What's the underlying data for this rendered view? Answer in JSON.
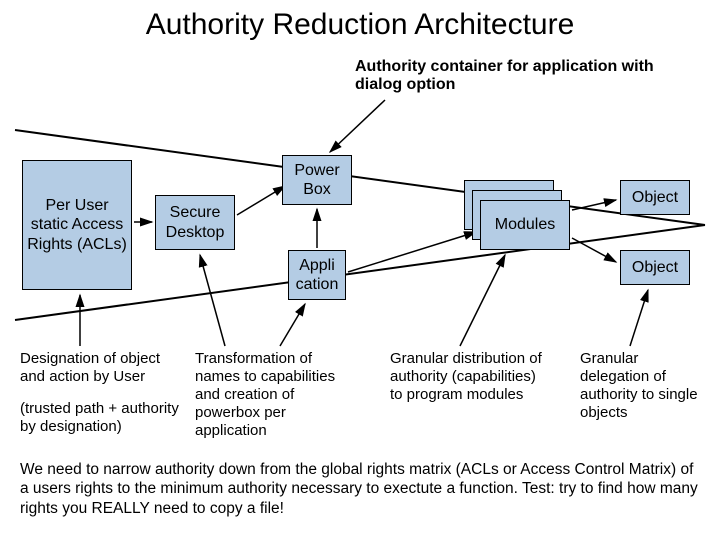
{
  "title": "Authority Reduction Architecture",
  "subtitle": "Authority container for application with dialog option",
  "boxes": {
    "acl": "Per User static Access Rights (ACLs)",
    "secure_desktop": "Secure Desktop",
    "power_box": "Power Box",
    "application": "Appli cation",
    "modules": "Modules",
    "object1": "Object",
    "object2": "Object"
  },
  "captions": {
    "c1": "Designation of object and action by User",
    "c1b": "(trusted path + authority by designation)",
    "c2": "Transformation of names to capabilities and creation of powerbox per application",
    "c3": "Granular distribution of authority (capabilities) to program modules",
    "c4": "Granular delegation of authority to single objects"
  },
  "footer": "We need to narrow authority down from the global rights matrix (ACLs or Access Control Matrix) of a users rights to the minimum authority necessary to exectute a function. Test: try to find how many rights you REALLY need to copy a file!",
  "chart_data": {
    "type": "diagram",
    "nodes": [
      {
        "id": "acl",
        "label": "Per User static Access Rights (ACLs)"
      },
      {
        "id": "secure_desktop",
        "label": "Secure Desktop"
      },
      {
        "id": "power_box",
        "label": "Power Box"
      },
      {
        "id": "application",
        "label": "Application"
      },
      {
        "id": "modules",
        "label": "Modules",
        "stacked": true
      },
      {
        "id": "object1",
        "label": "Object"
      },
      {
        "id": "object2",
        "label": "Object"
      }
    ],
    "edges": [
      {
        "from": "subtitle",
        "to": "power_box"
      },
      {
        "from": "acl",
        "to": "secure_desktop"
      },
      {
        "from": "secure_desktop",
        "to": "power_box"
      },
      {
        "from": "application",
        "to": "power_box"
      },
      {
        "from": "application",
        "to": "modules"
      },
      {
        "from": "modules",
        "to": "object1"
      },
      {
        "from": "modules",
        "to": "object2"
      },
      {
        "from": "caption_c1",
        "to": "acl"
      },
      {
        "from": "caption_c2",
        "to": "secure_desktop"
      },
      {
        "from": "caption_c2",
        "to": "application"
      },
      {
        "from": "caption_c3",
        "to": "modules"
      },
      {
        "from": "caption_c4",
        "to": "object2"
      }
    ],
    "funnel_lines": [
      {
        "from": [
          15,
          130
        ],
        "to": [
          705,
          225
        ]
      },
      {
        "from": [
          15,
          320
        ],
        "to": [
          705,
          225
        ]
      }
    ],
    "annotations": [
      "Designation of object and action by User (trusted path + authority by designation)",
      "Transformation of names to capabilities and creation of powerbox per application",
      "Granular distribution of authority (capabilities) to program modules",
      "Granular delegation of authority to single objects"
    ]
  }
}
